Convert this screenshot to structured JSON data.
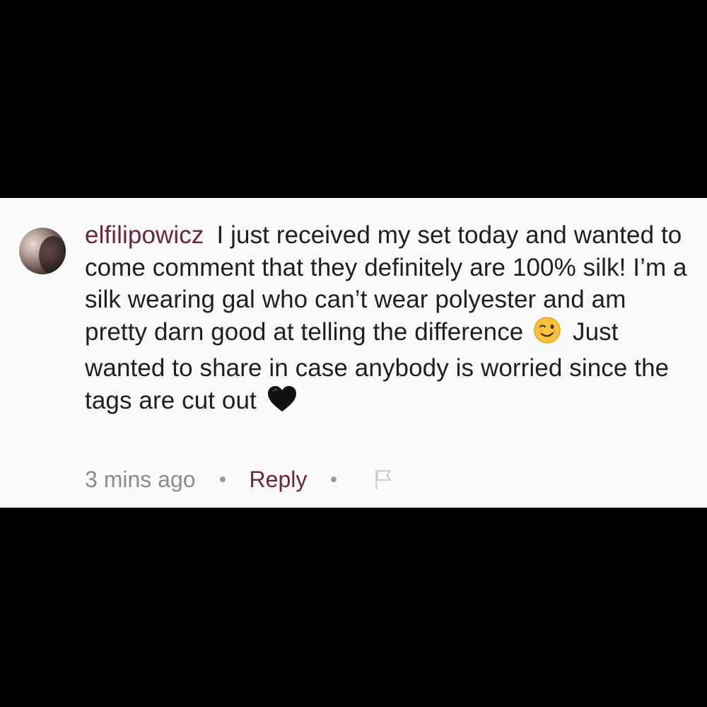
{
  "colors": {
    "background": "#000000",
    "card": "#fafafa",
    "username": "#6b2737",
    "text": "#1f1f1f",
    "meta": "#8c8c8c"
  },
  "comment": {
    "username": "elfilipowicz",
    "text_part1": "I just received my set today and wanted to come comment that they definitely are 100% silk! I’m a silk wearing gal who can’t wear polyester and am pretty darn good at telling the difference",
    "emoji1": "winking-face",
    "text_part2": "Just wanted to share in case anybody is worried since the tags are cut out",
    "emoji2": "black-heart",
    "timestamp": "3 mins ago",
    "reply_label": "Reply",
    "flag_icon": "flag-icon",
    "avatar_icon": "avatar"
  }
}
